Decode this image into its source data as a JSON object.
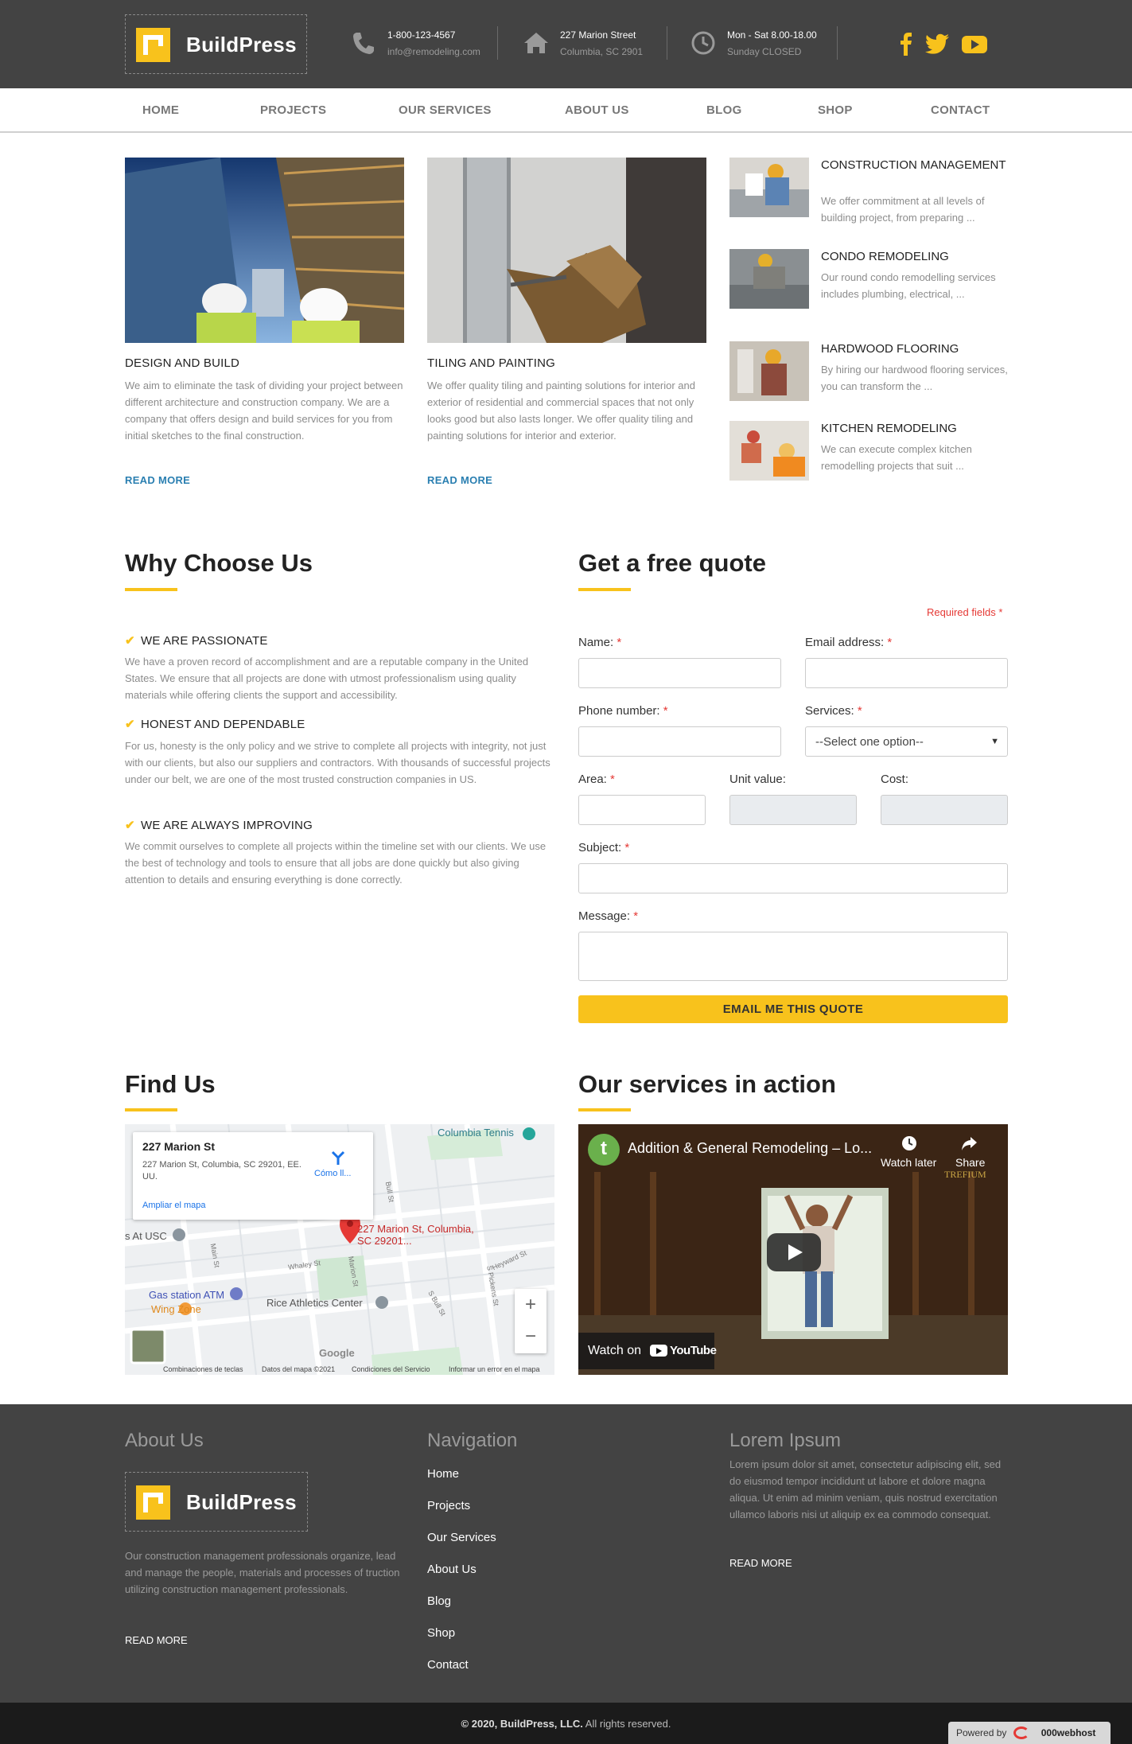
{
  "brand": {
    "name": "BuildPress",
    "accent": "#f8c21c",
    "dark": "#434343"
  },
  "header": {
    "phone": "1-800-123-4567",
    "email": "info@remodeling.com",
    "street": "227 Marion Street",
    "city": "Columbia, SC 2901",
    "hours": "Mon - Sat 8.00-18.00",
    "closed": "Sunday CLOSED"
  },
  "nav": {
    "items": [
      "HOME",
      "PROJECTS",
      "OUR SERVICES",
      "ABOUT US",
      "BLOG",
      "SHOP",
      "CONTACT"
    ]
  },
  "features": [
    {
      "title": "DESIGN AND BUILD",
      "text": "We aim to eliminate the task of dividing your project between different architecture and construction company. We are a company that offers design and build services for you from initial sketches to the final construction.",
      "link": "READ MORE"
    },
    {
      "title": "TILING AND PAINTING",
      "text": "We offer quality tiling and painting solutions for interior and exterior of residential and commercial spaces that not only looks good but also lasts longer. We offer quality tiling and painting solutions for interior and exterior.",
      "link": "READ MORE"
    }
  ],
  "services": [
    {
      "title": "CONSTRUCTION MANAGEMENT",
      "text": "We offer commitment at all levels of building project, from preparing ..."
    },
    {
      "title": "CONDO REMODELING",
      "text": "Our round condo remodelling services includes plumbing, electrical, ..."
    },
    {
      "title": "HARDWOOD FLOORING",
      "text": "By hiring our hardwood flooring services, you can transform the ..."
    },
    {
      "title": "KITCHEN REMODELING",
      "text": "We can execute complex kitchen remodelling projects that suit ..."
    }
  ],
  "why": {
    "heading": "Why Choose Us",
    "items": [
      {
        "title": "WE ARE PASSIONATE",
        "text": "We have a proven record of accomplishment and are a reputable company in the United States. We ensure that all projects are done with utmost professionalism using quality materials while offering clients the support and accessibility."
      },
      {
        "title": "HONEST AND DEPENDABLE",
        "text": "For us, honesty is the only policy and we strive to complete all projects with integrity, not just with our clients, but also our suppliers and contractors. With thousands of successful projects under our belt, we are one of the most trusted construction companies in US."
      },
      {
        "title": "WE ARE ALWAYS IMPROVING",
        "text": "We commit ourselves to complete all projects within the timeline set with our clients. We use the best of technology and tools to ensure that all jobs are done quickly but also giving attention to details and ensuring everything is done correctly."
      }
    ]
  },
  "quote": {
    "heading": "Get a free quote",
    "required_note": "Required fields *",
    "labels": {
      "name": "Name:",
      "email": "Email address:",
      "phone": "Phone number:",
      "services": "Services:",
      "area": "Area:",
      "unit": "Unit value:",
      "cost": "Cost:",
      "subject": "Subject:",
      "message": "Message:"
    },
    "star": "*",
    "select_value": "--Select one option--",
    "button": "EMAIL ME THIS QUOTE"
  },
  "find": {
    "heading": "Find Us",
    "card_title": "227 Marion St",
    "card_address": "227 Marion St, Columbia, SC 29201, EE. UU.",
    "card_link": "Ampliar el mapa",
    "directions": "Cómo ll...",
    "pin_label": "227 Marion St, Columbia, SC 29201...",
    "places": [
      "Columbia Tennis",
      "s At USC",
      "Gas station ATM",
      "Wing Zone",
      "Rice Athletics Center",
      "Google"
    ],
    "streets": [
      "Main St",
      "Whaley St",
      "Marion St",
      "Bull St",
      "S Bull St",
      "S Pickens St",
      "Heyward St"
    ],
    "footer": [
      "Combinaciones de teclas",
      "Datos del mapa ©2021",
      "Condiciones del Servicio",
      "Informar un error en el mapa"
    ]
  },
  "video": {
    "heading": "Our services in action",
    "title": "Addition & General Remodeling – Lo...",
    "watch_later": "Watch later",
    "share": "Share",
    "watch_on": "Watch on",
    "youtube": "YouTube",
    "channel_letter": "t",
    "watermark": "TREFIUM"
  },
  "footer": {
    "about_heading": "About Us",
    "about_text": "Our construction management professionals organize, lead and manage the people, materials and processes of truction utilizing construction management professionals.",
    "about_link": "READ MORE",
    "nav_heading": "Navigation",
    "nav_links": [
      "Home",
      "Projects",
      "Our Services",
      "About Us",
      "Blog",
      "Shop",
      "Contact"
    ],
    "lorem_heading": "Lorem Ipsum",
    "lorem_text": "Lorem ipsum dolor sit amet, consectetur adipiscing elit, sed do eiusmod tempor incididunt ut labore et dolore magna aliqua. Ut enim ad minim veniam, quis nostrud exercitation ullamco laboris nisi ut aliquip ex ea commodo consequat.",
    "lorem_link": "READ MORE",
    "copyright_bold": "© 2020, BuildPress, LLC.",
    "copyright_rest": " All rights reserved.",
    "powered": "Powered by",
    "host": "000webhost"
  }
}
